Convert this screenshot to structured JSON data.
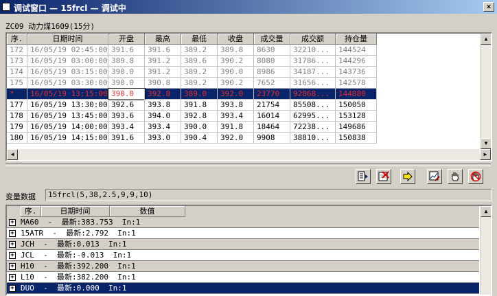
{
  "window": {
    "title": "调试窗口 — 15frcl — 调试中",
    "close_glyph": "×"
  },
  "subtitle": "ZC09 动力煤1609(15分)",
  "quote_grid": {
    "columns": [
      "序.",
      "日期时间",
      "开盘",
      "最高",
      "最低",
      "收盘",
      "成交量",
      "成交额",
      "持仓量"
    ],
    "rows": [
      {
        "cells": [
          "172",
          "16/05/19 02:45:00",
          "391.6",
          "391.6",
          "389.2",
          "389.8",
          "8630",
          "32210...",
          "144524"
        ],
        "style": "dim"
      },
      {
        "cells": [
          "173",
          "16/05/19 03:00:00",
          "389.8",
          "391.2",
          "389.6",
          "390.2",
          "8080",
          "31786...",
          "144296"
        ],
        "style": "dim"
      },
      {
        "cells": [
          "174",
          "16/05/19 03:15:00",
          "390.0",
          "391.2",
          "389.2",
          "390.0",
          "8986",
          "34187...",
          "143736"
        ],
        "style": "dim"
      },
      {
        "cells": [
          "175",
          "16/05/19 03:30:00",
          "390.0",
          "390.8",
          "389.2",
          "390.2",
          "7652",
          "31656...",
          "142578"
        ],
        "style": "dim"
      },
      {
        "cells": [
          "*",
          "16/05/19 13:15:00",
          "390.0",
          "392.8",
          "389.0",
          "392.0",
          "23770",
          "92868...",
          "144880"
        ],
        "style": "sel"
      },
      {
        "cells": [
          "177",
          "16/05/19 13:30:00",
          "392.6",
          "393.8",
          "391.8",
          "393.8",
          "21754",
          "85508...",
          "150050"
        ],
        "style": ""
      },
      {
        "cells": [
          "178",
          "16/05/19 13:45:00",
          "393.6",
          "394.0",
          "392.8",
          "393.4",
          "16014",
          "62995...",
          "153128"
        ],
        "style": ""
      },
      {
        "cells": [
          "179",
          "16/05/19 14:00:00",
          "393.4",
          "393.4",
          "390.0",
          "391.8",
          "18464",
          "72238...",
          "149686"
        ],
        "style": ""
      },
      {
        "cells": [
          "180",
          "16/05/19 14:15:00",
          "391.6",
          "393.0",
          "390.4",
          "392.0",
          "9908",
          "38810...",
          "150838"
        ],
        "style": ""
      }
    ]
  },
  "toolbar": {
    "buttons": [
      "export-list-icon",
      "delete-sheet-icon",
      "arrow-right-icon",
      "chart-edit-icon",
      "hand-icon",
      "hand-stop-icon"
    ]
  },
  "variables": {
    "label": "变量数据",
    "value": "15frcl(5,38,2.5,9,9,10)"
  },
  "var_tree": {
    "columns": [
      "序.",
      "日期时间",
      "数值"
    ],
    "items": [
      "MA60  -  最新:383.753  In:1",
      "15ATR  -  最新:2.792  In:1",
      "JCH  -  最新:0.013  In:1",
      "JCL  -  最新:-0.013  In:1",
      "H10  -  最新:392.200  In:1",
      "L10  -  最新:382.200  In:1",
      "DUO  -  最新:0.000  In:1"
    ],
    "selected_index": 6
  },
  "scroll_glyphs": {
    "up": "▲",
    "down": "▼",
    "left": "◀",
    "right": "▶"
  },
  "colors": {
    "title_start": "#0a246a",
    "title_end": "#a6caf0",
    "selection": "#0a246a",
    "selected_text": "#e03030",
    "face": "#d4d0c8"
  }
}
